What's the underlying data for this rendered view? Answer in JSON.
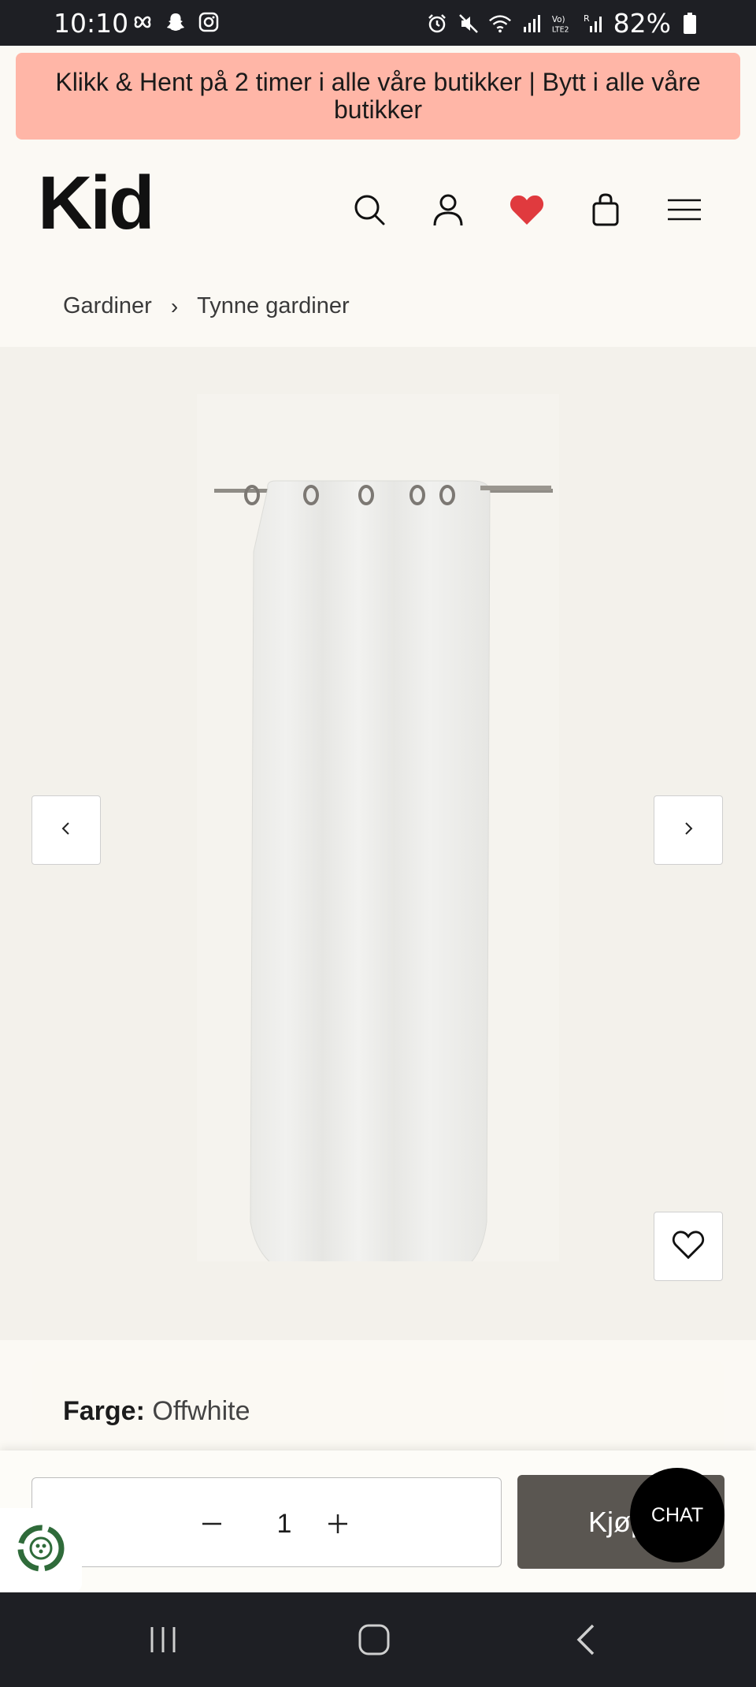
{
  "status_bar": {
    "time": "10:10",
    "battery": "82%",
    "left_icons": [
      "pinwheel-icon",
      "snapchat-icon",
      "instagram-icon"
    ],
    "right_icons": [
      "alarm-icon",
      "mute-icon",
      "wifi-icon",
      "signal-icon",
      "volte-icon",
      "signal-roaming-icon",
      "battery-icon"
    ]
  },
  "promo_banner": {
    "text": "Klikk & Hent på 2 timer i alle våre butikker | Bytt i alle våre butikker",
    "background": "#ffb6a7"
  },
  "header": {
    "logo": "Kid",
    "icons": [
      "search-icon",
      "account-icon",
      "wishlist-heart-icon",
      "shopping-bag-icon",
      "menu-icon"
    ],
    "wishlist_color": "#e03a3e"
  },
  "breadcrumb": {
    "items": [
      "Gardiner",
      "Tynne gardiner"
    ],
    "separator": "›"
  },
  "gallery": {
    "prev_icon": "chevron-left-icon",
    "next_icon": "chevron-right-icon",
    "favorite_icon": "heart-outline-icon"
  },
  "color_selector": {
    "label": "Farge:",
    "value": "Offwhite"
  },
  "purchase": {
    "quantity": "1",
    "buy_label": "Kjøp",
    "chat_label": "CHAT",
    "buy_color": "#5a5651"
  },
  "android_nav": [
    "recents-icon",
    "home-icon",
    "back-icon"
  ]
}
